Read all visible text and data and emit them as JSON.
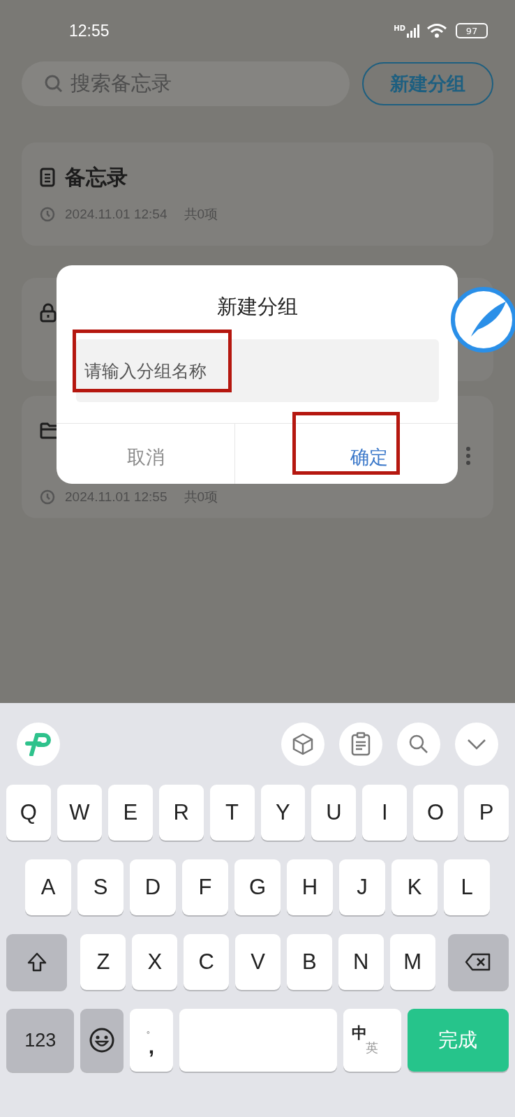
{
  "status_bar": {
    "time": "12:55",
    "network": "HD",
    "battery": "97"
  },
  "search": {
    "placeholder": "搜索备忘录"
  },
  "new_group_button": "新建分组",
  "groups": [
    {
      "kind": "notes",
      "title": "备忘录",
      "date": "2024.11.01 12:54",
      "count": "共0项"
    },
    {
      "kind": "locked"
    },
    {
      "kind": "folder",
      "date": "2024.11.01 12:55",
      "count": "共0项"
    }
  ],
  "dialog": {
    "title": "新建分组",
    "input": {
      "placeholder": "请输入分组名称"
    },
    "buttons": [
      {
        "kind": "cancel",
        "label": "取消"
      },
      {
        "kind": "confirm",
        "label": "确定"
      }
    ]
  },
  "keyboard": {
    "rows": [
      [
        "Q",
        "W",
        "E",
        "R",
        "T",
        "Y",
        "U",
        "I",
        "O",
        "P"
      ],
      [
        "A",
        "S",
        "D",
        "F",
        "G",
        "H",
        "J",
        "K",
        "L"
      ],
      [
        "Z",
        "X",
        "C",
        "V",
        "B",
        "N",
        "M"
      ]
    ],
    "numbers_key": "123",
    "punct_top": "。",
    "punct_bottom": ",",
    "lang_main": "中",
    "lang_alt": "英",
    "done_key": "完成"
  }
}
